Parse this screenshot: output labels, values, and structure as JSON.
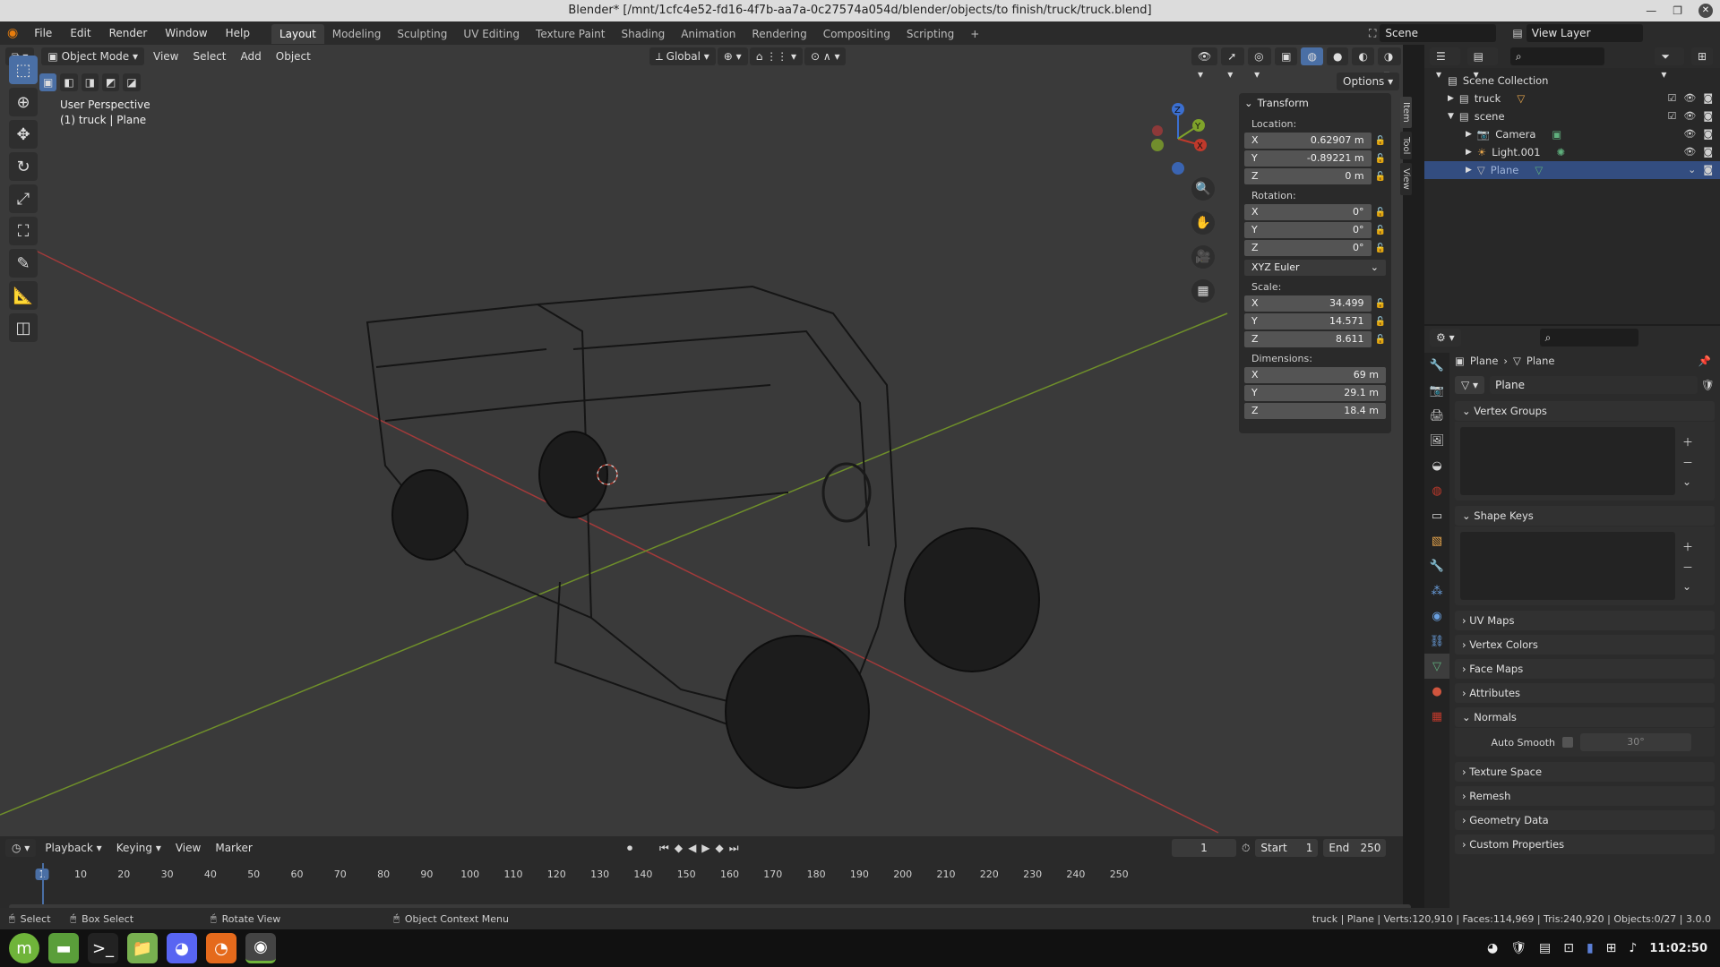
{
  "title": "Blender* [/mnt/1cfc4e52-fd16-4f7b-aa7a-0c27574a054d/blender/objects/to finish/truck/truck.blend]",
  "menu": [
    "File",
    "Edit",
    "Render",
    "Window",
    "Help"
  ],
  "workspaces": [
    "Layout",
    "Modeling",
    "Sculpting",
    "UV Editing",
    "Texture Paint",
    "Shading",
    "Animation",
    "Rendering",
    "Compositing",
    "Scripting"
  ],
  "scene": "Scene",
  "view_layer": "View Layer",
  "viewport": {
    "mode": "Object Mode",
    "menus": [
      "View",
      "Select",
      "Add",
      "Object"
    ],
    "orientation": "Global",
    "options": "Options",
    "overlay_title": "User Perspective",
    "overlay_subtitle": "(1) truck | Plane"
  },
  "transform": {
    "header": "Transform",
    "location_label": "Location:",
    "location": [
      {
        "axis": "X",
        "value": "0.62907 m"
      },
      {
        "axis": "Y",
        "value": "-0.89221 m"
      },
      {
        "axis": "Z",
        "value": "0 m"
      }
    ],
    "rotation_label": "Rotation:",
    "rotation": [
      {
        "axis": "X",
        "value": "0°"
      },
      {
        "axis": "Y",
        "value": "0°"
      },
      {
        "axis": "Z",
        "value": "0°"
      }
    ],
    "rotation_mode": "XYZ Euler",
    "scale_label": "Scale:",
    "scale": [
      {
        "axis": "X",
        "value": "34.499"
      },
      {
        "axis": "Y",
        "value": "14.571"
      },
      {
        "axis": "Z",
        "value": "8.611"
      }
    ],
    "dimensions_label": "Dimensions:",
    "dimensions": [
      {
        "axis": "X",
        "value": "69 m"
      },
      {
        "axis": "Y",
        "value": "29.1 m"
      },
      {
        "axis": "Z",
        "value": "18.4 m"
      }
    ]
  },
  "side_tabs": [
    "Item",
    "Tool",
    "View"
  ],
  "outliner": {
    "root": "Scene Collection",
    "items": [
      {
        "label": "truck",
        "indent": 1
      },
      {
        "label": "scene",
        "indent": 1
      },
      {
        "label": "Camera",
        "indent": 2
      },
      {
        "label": "Light.001",
        "indent": 2
      },
      {
        "label": "Plane",
        "indent": 2
      }
    ]
  },
  "properties": {
    "breadcrumb_object": "Plane",
    "breadcrumb_data": "Plane",
    "data_name": "Plane",
    "panels": {
      "vertex_groups": "Vertex Groups",
      "shape_keys": "Shape Keys",
      "uv_maps": "UV Maps",
      "vertex_colors": "Vertex Colors",
      "face_maps": "Face Maps",
      "attributes": "Attributes",
      "normals": "Normals",
      "auto_smooth": "Auto Smooth",
      "auto_smooth_angle": "30°",
      "texture_space": "Texture Space",
      "remesh": "Remesh",
      "geometry_data": "Geometry Data",
      "custom_properties": "Custom Properties"
    }
  },
  "timeline": {
    "menus": [
      "Playback",
      "Keying",
      "View",
      "Marker"
    ],
    "current_frame": "1",
    "start_label": "Start",
    "start": "1",
    "end_label": "End",
    "end": "250",
    "ticks": [
      "1",
      "10",
      "20",
      "30",
      "40",
      "50",
      "60",
      "70",
      "80",
      "90",
      "100",
      "110",
      "120",
      "130",
      "140",
      "150",
      "160",
      "170",
      "180",
      "190",
      "200",
      "210",
      "220",
      "230",
      "240",
      "250"
    ]
  },
  "statusbar": {
    "select": "Select",
    "box_select": "Box Select",
    "rotate_view": "Rotate View",
    "context_menu": "Object Context Menu",
    "stats": "truck | Plane | Verts:120,910 | Faces:114,969 | Tris:240,920 | Objects:0/27 | 3.0.0"
  },
  "taskbar": {
    "clock": "11:02:50"
  },
  "colors": {
    "accent": "#4a6fa5",
    "selected_row": "#334d80",
    "x_axis": "#c0392b",
    "y_axis": "#7fa32a"
  }
}
